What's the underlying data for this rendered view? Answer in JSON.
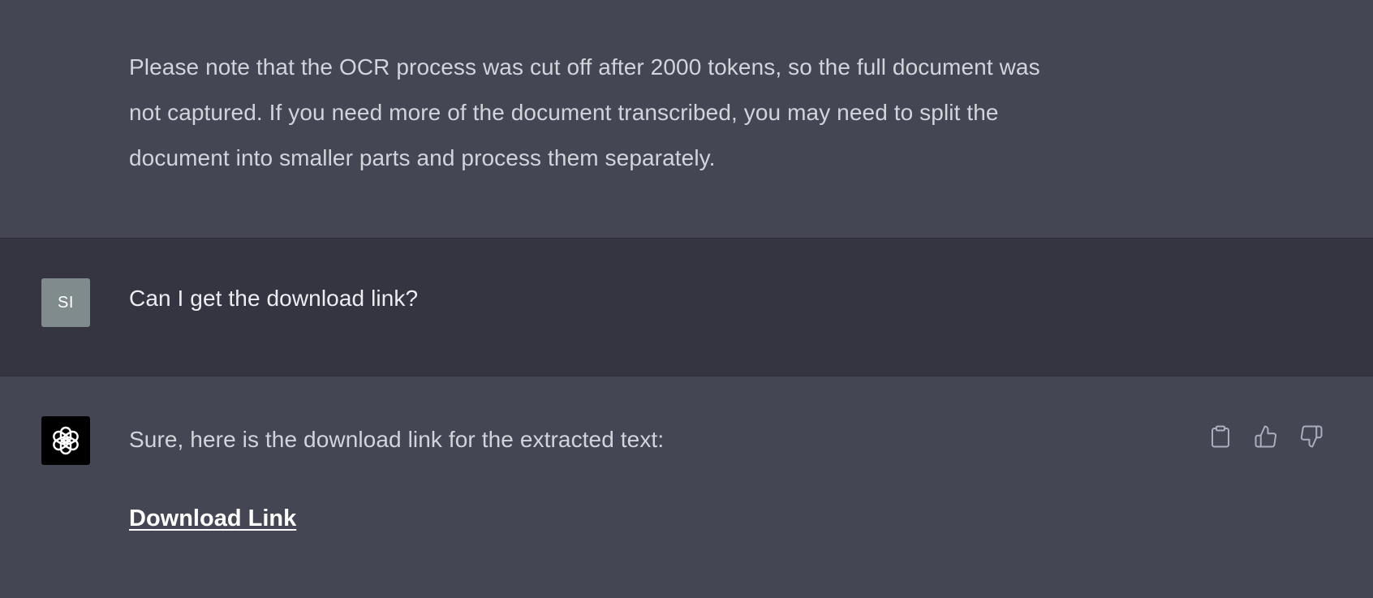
{
  "previous_assistant_message": {
    "lines": [
      "Please note that the OCR process was cut off after 2000 tokens, so the full document was",
      "not captured. If you need more of the document transcribed, you may need to split the",
      "document into smaller parts and process them separately."
    ]
  },
  "user_message": {
    "avatar_initials": "SI",
    "text": "Can I get the download link?"
  },
  "assistant_message": {
    "avatar_icon": "openai-logo-icon",
    "text": "Sure, here is the download link for the extracted text:",
    "link_label": "Download Link",
    "actions": [
      {
        "name": "copy",
        "icon": "clipboard-icon"
      },
      {
        "name": "thumbs-up",
        "icon": "thumbs-up-icon"
      },
      {
        "name": "thumbs-down",
        "icon": "thumbs-down-icon"
      }
    ]
  },
  "colors": {
    "assistant_bg": "#444654",
    "user_bg": "#343541",
    "text": "#d1d5db",
    "user_avatar_bg": "#7f8b8c",
    "assistant_avatar_bg": "#000000",
    "icon": "#acacbe"
  }
}
